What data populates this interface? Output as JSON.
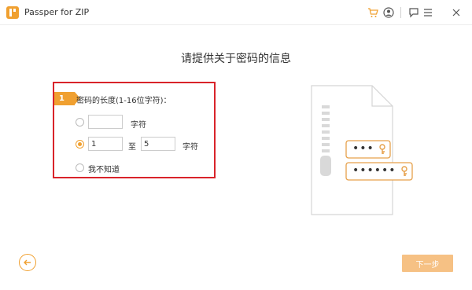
{
  "app": {
    "title": "Passper for ZIP",
    "accent": "#f0a030",
    "highlight": "#d9232a"
  },
  "titlebar_icons": [
    "cart-icon",
    "account-icon",
    "feedback-icon",
    "menu-icon",
    "close-icon"
  ],
  "main": {
    "title": "请提供关于密码的信息"
  },
  "panel": {
    "step_number": "1",
    "label": "密码的长度(1-16位字符)：",
    "options": [
      {
        "id": "exact",
        "selected": false,
        "value": "",
        "unit": "字符"
      },
      {
        "id": "range",
        "selected": true,
        "from": "1",
        "to_label": "至",
        "to": "5",
        "unit": "字符"
      },
      {
        "id": "unknown",
        "selected": false,
        "label": "我不知道"
      }
    ]
  },
  "illustration": {
    "short_mask": "•••",
    "long_mask": "••••••"
  },
  "footer": {
    "next_label": "下一步"
  }
}
